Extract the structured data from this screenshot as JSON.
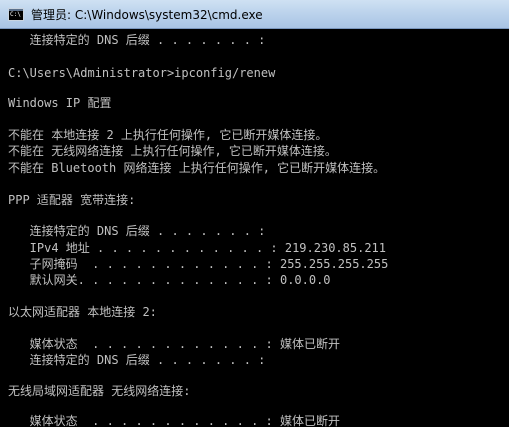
{
  "window": {
    "title": "管理员: C:\\Windows\\system32\\cmd.exe",
    "icon": "cmd-icon",
    "icon_text": "C:\\"
  },
  "console": {
    "lines": [
      "   连接特定的 DNS 后缀 . . . . . . . :",
      "",
      "C:\\Users\\Administrator>ipconfig/renew",
      "",
      "Windows IP 配置",
      "",
      "不能在 本地连接 2 上执行任何操作, 它已断开媒体连接。",
      "不能在 无线网络连接 上执行任何操作, 它已断开媒体连接。",
      "不能在 Bluetooth 网络连接 上执行任何操作, 它已断开媒体连接。",
      "",
      "PPP 适配器 宽带连接:",
      "",
      "   连接特定的 DNS 后缀 . . . . . . . :",
      "   IPv4 地址 . . . . . . . . . . . . : 219.230.85.211",
      "   子网掩码  . . . . . . . . . . . . : 255.255.255.255",
      "   默认网关. . . . . . . . . . . . . : 0.0.0.0",
      "",
      "以太网适配器 本地连接 2:",
      "",
      "   媒体状态  . . . . . . . . . . . . : 媒体已断开",
      "   连接特定的 DNS 后缀 . . . . . . . :",
      "",
      "无线局域网适配器 无线网络连接:",
      "",
      "   媒体状态  . . . . . . . . . . . . : 媒体已断开"
    ]
  }
}
